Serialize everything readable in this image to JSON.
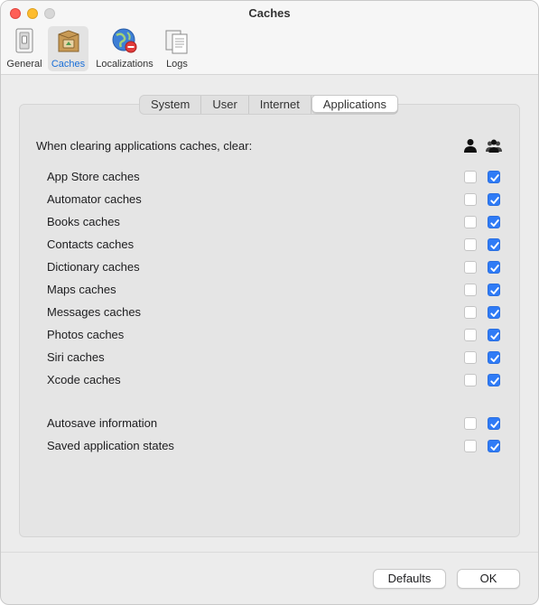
{
  "window": {
    "title": "Caches"
  },
  "toolbar": {
    "items": [
      {
        "label": "General",
        "icon": "general-switch-icon"
      },
      {
        "label": "Caches",
        "icon": "caches-box-icon",
        "selected": true
      },
      {
        "label": "Localizations",
        "icon": "globe-icon"
      },
      {
        "label": "Logs",
        "icon": "documents-icon"
      }
    ]
  },
  "tabs": [
    {
      "label": "System"
    },
    {
      "label": "User"
    },
    {
      "label": "Internet"
    },
    {
      "label": "Applications",
      "active": true
    }
  ],
  "section": {
    "header": "When clearing applications caches, clear:",
    "columns": [
      "single-user-icon",
      "multiple-users-icon"
    ]
  },
  "rows": [
    {
      "label": "App Store caches",
      "user": false,
      "all_users": true
    },
    {
      "label": "Automator caches",
      "user": false,
      "all_users": true
    },
    {
      "label": "Books caches",
      "user": false,
      "all_users": true
    },
    {
      "label": "Contacts caches",
      "user": false,
      "all_users": true
    },
    {
      "label": "Dictionary caches",
      "user": false,
      "all_users": true
    },
    {
      "label": "Maps caches",
      "user": false,
      "all_users": true
    },
    {
      "label": "Messages caches",
      "user": false,
      "all_users": true
    },
    {
      "label": "Photos caches",
      "user": false,
      "all_users": true
    },
    {
      "label": "Siri caches",
      "user": false,
      "all_users": true
    },
    {
      "label": "Xcode caches",
      "user": false,
      "all_users": true
    },
    {
      "label": "Autosave information",
      "user": false,
      "all_users": true
    },
    {
      "label": "Saved application states",
      "user": false,
      "all_users": true
    }
  ],
  "buttons": {
    "defaults": "Defaults",
    "ok": "OK"
  },
  "colors": {
    "accent": "#2f7bf6",
    "selected_label": "#1a6fd8"
  }
}
